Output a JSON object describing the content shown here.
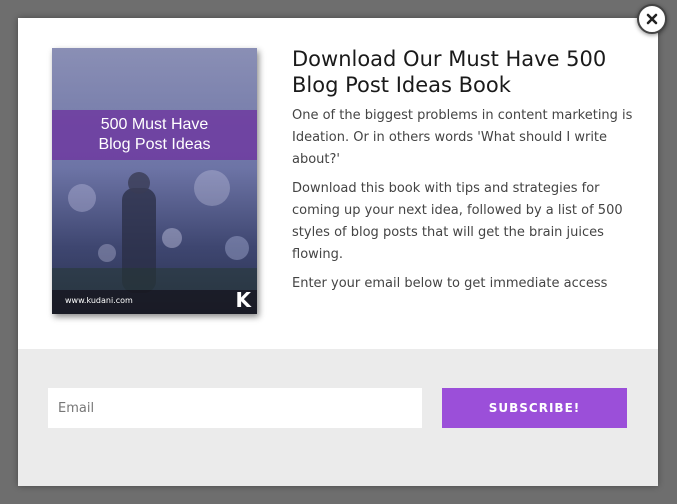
{
  "colors": {
    "overlay": "#6e6e6e",
    "accent": "#9b4fd9",
    "book_band": "#6e3ca0",
    "form_band": "#ebebeb"
  },
  "icons": {
    "close": "close-icon",
    "book_logo": "k-logo"
  },
  "popup": {
    "title": "Download Our Must Have 500 Blog Post Ideas Book",
    "paragraph_1": "One of the biggest problems in content marketing is Ideation.  Or in others words 'What should I write about?'",
    "paragraph_2": "Download this book with tips and strategies for coming up your next idea, followed by a list of 500 styles of blog posts that will get the brain juices flowing.",
    "paragraph_3": "Enter your email below to get immediate access"
  },
  "book": {
    "title_line_1": "500 Must Have",
    "title_line_2": "Blog Post Ideas",
    "url": "www.kudani.com",
    "logo": "K"
  },
  "form": {
    "email_placeholder": "Email",
    "email_value": "",
    "subscribe_label": "SUBSCRIBE!"
  }
}
